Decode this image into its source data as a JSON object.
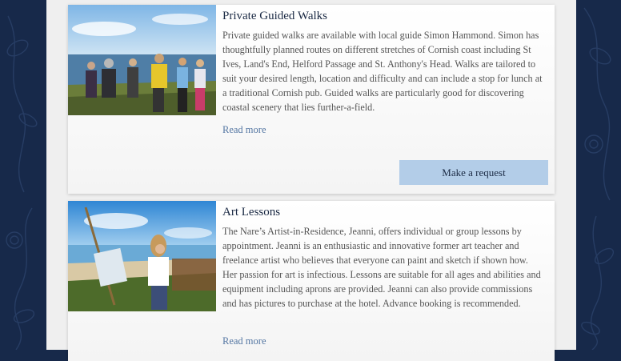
{
  "theme": {
    "background": "#17294a",
    "column": "#efefef",
    "link": "#5577a3",
    "button": "#b3cde8"
  },
  "cards": [
    {
      "title": "Private Guided Walks",
      "description": "Private guided walks are available with local guide Simon Hammond. Simon has thoughtfully planned routes on different stretches of Cornish coast including St Ives, Land's End, Helford Passage and St. Anthony's Head. Walks are tailored to suit your desired length, location and difficulty and can include a stop for lunch at a traditional Cornish pub. Guided walks are particularly good for discovering coastal scenery that lies further-a-field.",
      "read_more": "Read more",
      "button": "Make a request"
    },
    {
      "title": "Art Lessons",
      "description": "The Nare’s Artist-in-Residence, Jeanni, offers individual or group lessons by appointment. Jeanni is an enthusiastic and innovative former art teacher and freelance artist who believes that everyone can paint and sketch if shown how. Her passion for art is infectious. Lessons are suitable for all ages and abilities and equipment including aprons are provided. Jeanni can also provide commissions and has pictures to purchase at the hotel. Advance booking is recommended.",
      "read_more": "Read more"
    }
  ]
}
